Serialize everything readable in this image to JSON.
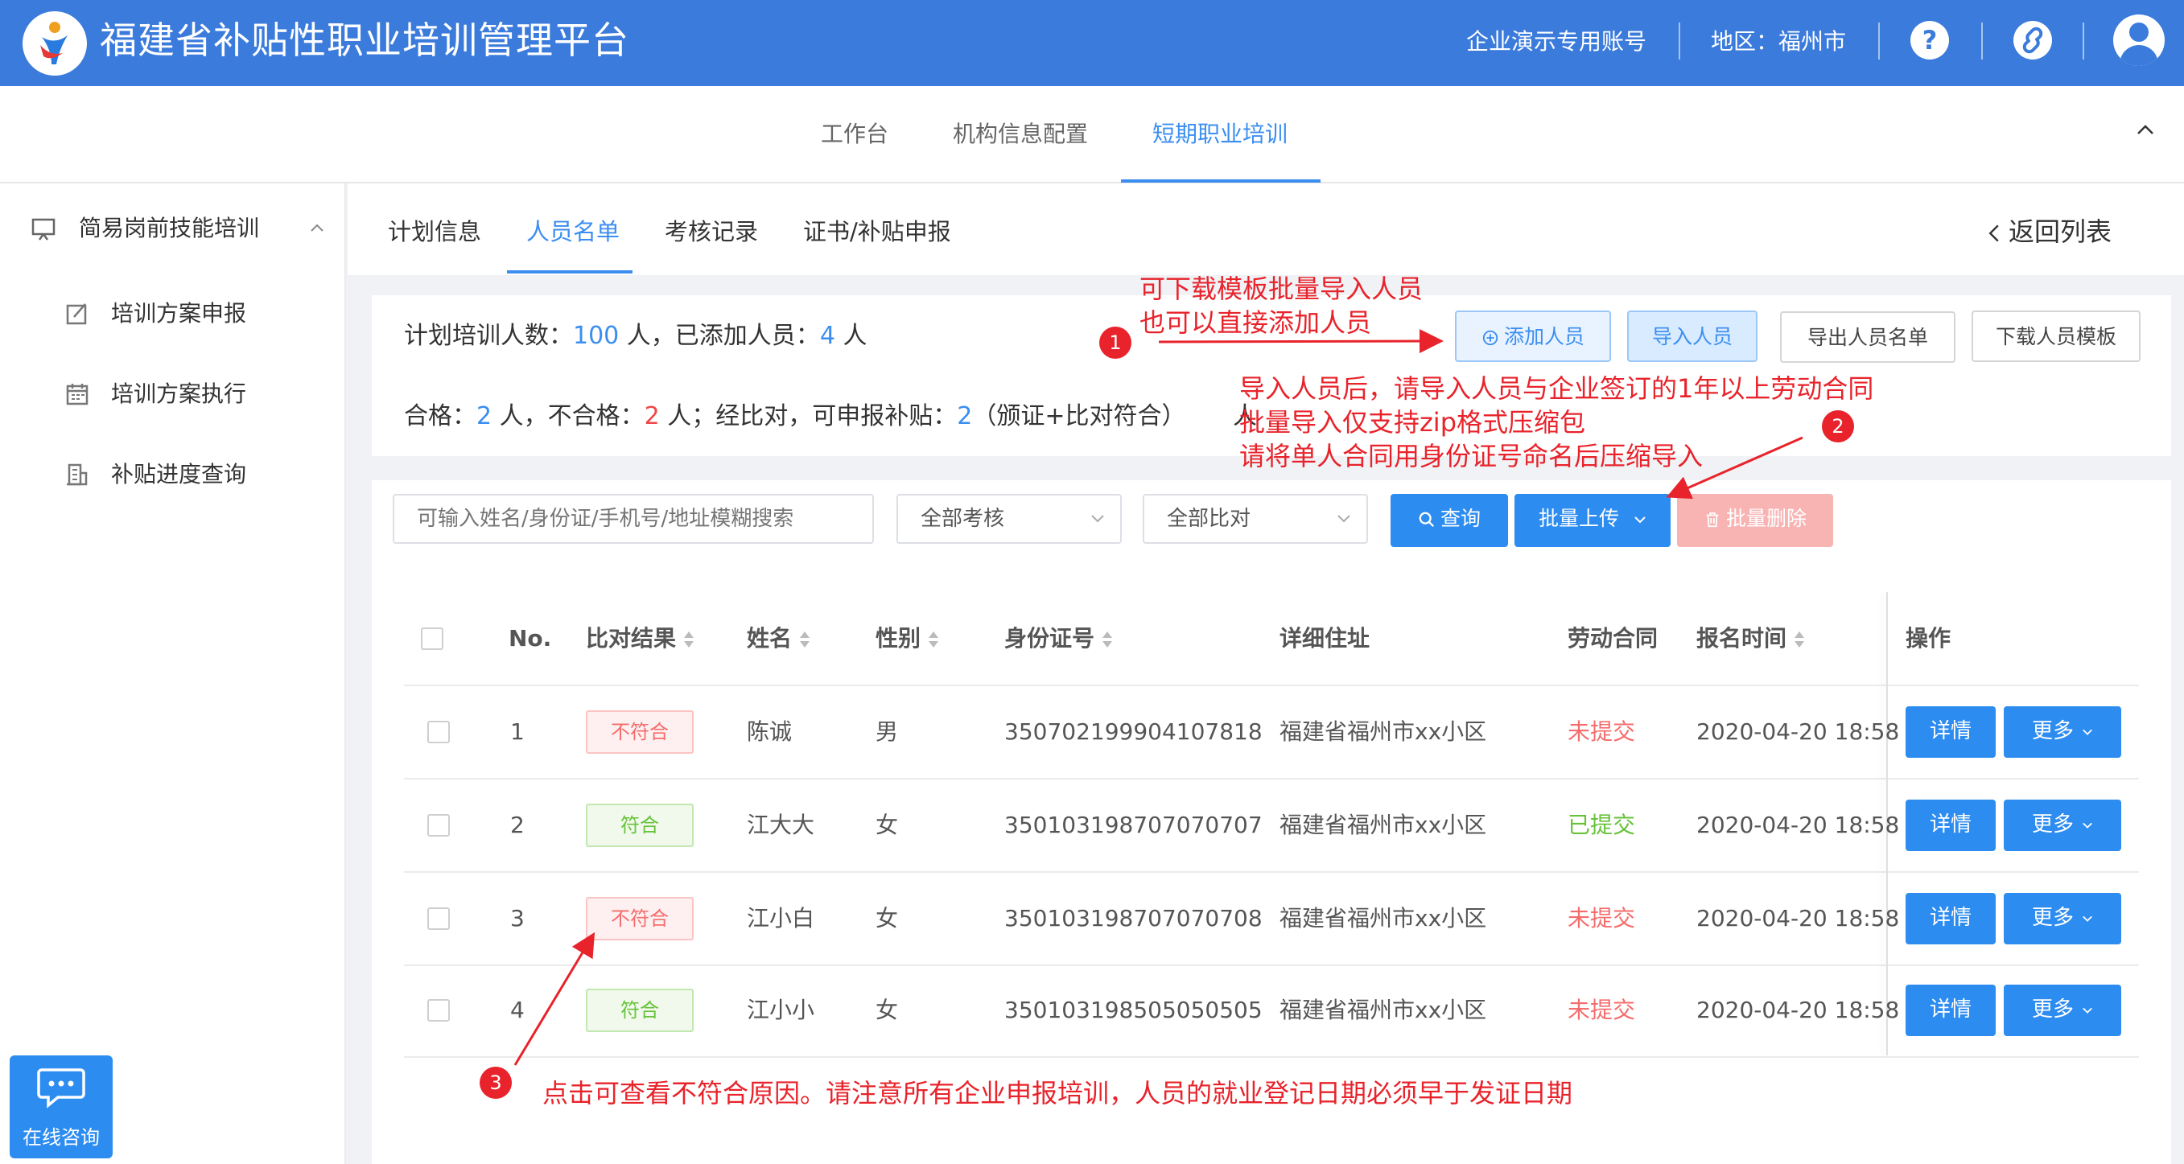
{
  "header": {
    "title": "福建省补贴性职业培训管理平台",
    "account": "企业演示专用账号",
    "region": "地区：福州市",
    "help_icon": "?"
  },
  "nav": {
    "items": [
      "工作台",
      "机构信息配置",
      "短期职业培训"
    ],
    "active_index": 2
  },
  "sidebar": {
    "group": "简易岗前技能培训",
    "items": [
      "培训方案申报",
      "培训方案执行",
      "补贴进度查询"
    ]
  },
  "tabs": {
    "items": [
      "计划信息",
      "人员名单",
      "考核记录",
      "证书/补贴申报"
    ],
    "active_index": 1,
    "back": "返回列表"
  },
  "summary": {
    "l1_a": "计划培训人数：",
    "planned": "100",
    "l1_b": " 人，已添加人员：",
    "added": "4",
    "l1_c": " 人",
    "l2_a": "合格：",
    "qualified": "2",
    "l2_b": " 人，不合格：",
    "unqualified": "2",
    "l2_c": " 人；经比对，可申报补贴：",
    "eligible": "2",
    "l2_d": "（颁证+比对符合）",
    "l2_e": "人"
  },
  "actions": {
    "add": "添加人员",
    "import": "导入人员",
    "export": "导出人员名单",
    "template": "下载人员模板"
  },
  "filters": {
    "search_placeholder": "可输入姓名/身份证/手机号/地址模糊搜索",
    "assess": "全部考核",
    "compare": "全部比对",
    "query": "查询",
    "batch_upload": "批量上传",
    "batch_delete": "批量删除"
  },
  "table": {
    "headers": [
      "No.",
      "比对结果",
      "姓名",
      "性别",
      "身份证号",
      "详细住址",
      "劳动合同",
      "报名时间",
      "操作"
    ],
    "rows": [
      {
        "no": "1",
        "result": "不符合",
        "name": "陈诚",
        "gender": "男",
        "id": "350702199904107818",
        "address": "福建省福州市xx小区",
        "contract": "未提交",
        "time": "2020-04-20 18:58"
      },
      {
        "no": "2",
        "result": "符合",
        "name": "江大大",
        "gender": "女",
        "id": "350103198707070707",
        "address": "福建省福州市xx小区",
        "contract": "已提交",
        "time": "2020-04-20 18:58"
      },
      {
        "no": "3",
        "result": "不符合",
        "name": "江小白",
        "gender": "女",
        "id": "350103198707070708",
        "address": "福建省福州市xx小区",
        "contract": "未提交",
        "time": "2020-04-20 18:58"
      },
      {
        "no": "4",
        "result": "符合",
        "name": "江小小",
        "gender": "女",
        "id": "350103198505050505",
        "address": "福建省福州市xx小区",
        "contract": "未提交",
        "time": "2020-04-20 18:58"
      }
    ],
    "detail_label": "详情",
    "more_label": "更多"
  },
  "annotations": {
    "m1": "1",
    "m2": "2",
    "m3": "3",
    "note1_line1": "可下载模板批量导入人员",
    "note1_line2": "也可以直接添加人员",
    "note2_line1": "导入人员后，请导入人员与企业签订的1年以上劳动合同",
    "note2_line2": "批量导入仅支持zip格式压缩包",
    "note2_line3": "请将单人合同用身份证号命名后压缩导入",
    "note3": "点击可查看不符合原因。请注意所有企业申报培训，人员的就业登记日期必须早于发证日期"
  },
  "chat": {
    "label": "在线咨询"
  }
}
